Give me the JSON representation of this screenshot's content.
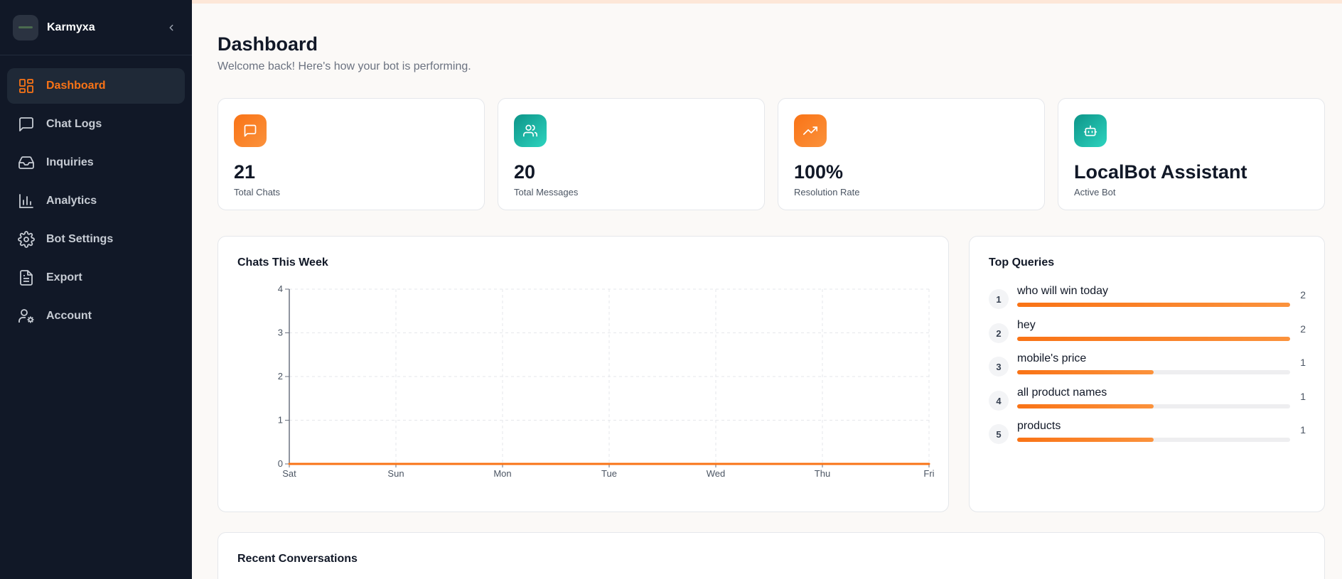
{
  "app": {
    "name": "Karmyxa"
  },
  "sidebar": {
    "items": [
      {
        "label": "Dashboard",
        "icon": "dashboard-icon",
        "active": true
      },
      {
        "label": "Chat Logs",
        "icon": "message-square-icon",
        "active": false
      },
      {
        "label": "Inquiries",
        "icon": "inbox-icon",
        "active": false
      },
      {
        "label": "Analytics",
        "icon": "bar-chart-icon",
        "active": false
      },
      {
        "label": "Bot Settings",
        "icon": "gear-icon",
        "active": false
      },
      {
        "label": "Export",
        "icon": "file-text-icon",
        "active": false
      },
      {
        "label": "Account",
        "icon": "user-settings-icon",
        "active": false
      }
    ]
  },
  "header": {
    "title": "Dashboard",
    "subtitle": "Welcome back! Here's how your bot is performing."
  },
  "stats": [
    {
      "value": "21",
      "label": "Total Chats",
      "icon": "message-square-icon",
      "color": "#f97316"
    },
    {
      "value": "20",
      "label": "Total Messages",
      "icon": "users-icon",
      "color": "#14b8a6"
    },
    {
      "value": "100%",
      "label": "Resolution Rate",
      "icon": "trending-up-icon",
      "color": "#f97316"
    },
    {
      "value": "LocalBot Assistant",
      "label": "Active Bot",
      "icon": "bot-icon",
      "color": "#14b8a6"
    }
  ],
  "chart_panel": {
    "title": "Chats This Week"
  },
  "chart_data": {
    "type": "line",
    "title": "Chats This Week",
    "categories": [
      "Sat",
      "Sun",
      "Mon",
      "Tue",
      "Wed",
      "Thu",
      "Fri"
    ],
    "values": [
      0,
      0,
      0,
      0,
      0,
      0,
      0
    ],
    "ylim": [
      0,
      4
    ],
    "yticks": [
      0,
      1,
      2,
      3,
      4
    ],
    "grid": true,
    "line_color": "#f97316"
  },
  "top_queries": {
    "title": "Top Queries",
    "max": 2,
    "items": [
      {
        "rank": "1",
        "text": "who will win today",
        "count": 2
      },
      {
        "rank": "2",
        "text": "hey",
        "count": 2
      },
      {
        "rank": "3",
        "text": "mobile's price",
        "count": 1
      },
      {
        "rank": "4",
        "text": "all product names",
        "count": 1
      },
      {
        "rank": "5",
        "text": "products",
        "count": 1
      }
    ]
  },
  "recent": {
    "title": "Recent Conversations"
  },
  "colors": {
    "accent": "#f97316",
    "teal": "#14b8a6",
    "sidebar_bg": "#111827"
  }
}
